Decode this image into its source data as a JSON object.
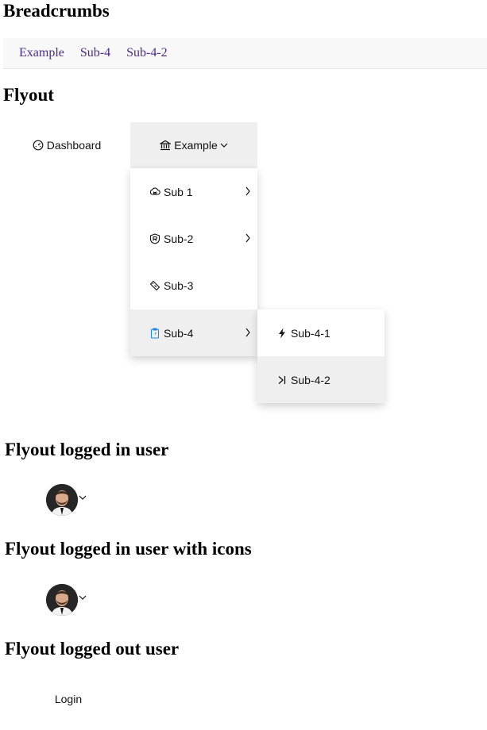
{
  "sections": {
    "breadcrumbs": "Breadcrumbs",
    "flyout": "Flyout",
    "logged_in": "Flyout logged in user",
    "logged_in_icons": "Flyout logged in user with icons",
    "logged_out": "Flyout logged out user"
  },
  "breadcrumbs": [
    "Example",
    "Sub-4",
    "Sub-4-2"
  ],
  "nav": {
    "dashboard": "Dashboard",
    "example": "Example"
  },
  "menu": {
    "items": [
      "Sub 1",
      "Sub-2",
      "Sub-3",
      "Sub-4"
    ],
    "active": "Sub-4",
    "submenu": [
      "Sub-4-1",
      "Sub-4-2"
    ],
    "submenu_active": "Sub-4-2"
  },
  "user_menu": {
    "login": "Login"
  },
  "colors": {
    "link": "#4a2a8a",
    "hover_bg": "#efefef",
    "active_icon": "#1e88e5"
  },
  "icons": {
    "dashboard": "gauge-icon",
    "example": "bank-icon",
    "sub1": "cloud-data-icon",
    "sub2": "shield-badge-icon",
    "sub3": "ticket-icon",
    "sub4": "clipboard-icon",
    "sub41": "lightning-icon",
    "sub42": "skip-forward-icon"
  }
}
